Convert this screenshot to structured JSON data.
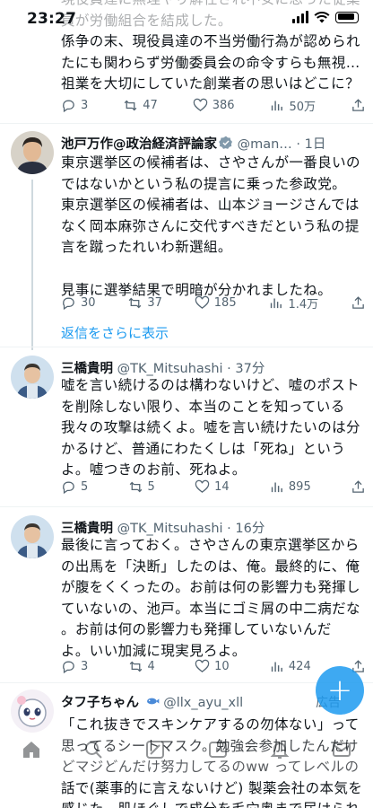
{
  "status_bar": {
    "time": "23:27"
  },
  "top_tweet": {
    "lines": [
      "現役員達に無理やり解任され不安に思った従業",
      "員が労働組合を結成した。",
      "係争の末、現役員達の不当労働行為が認められ",
      "たにも関わらず労働委員会の命令すらも無視…",
      "祖業を大切にしていた創業者の思いはどこに？"
    ],
    "actions": {
      "replies": "3",
      "retweets": "47",
      "likes": "386",
      "views": "50万"
    }
  },
  "tweet_ikedo": {
    "name": "池戸万作@政治経済評論家",
    "handle": "@man…",
    "time": "· 1日",
    "lines": [
      "東京選挙区の候補者は、さやさんが一番良いの",
      "ではないかという私の提言に乗った参政党。",
      "東京選挙区の候補者は、山本ジョージさんでは",
      "なく岡本麻弥さんに交代すべきだという私の提",
      "言を蹴ったれいわ新選組。",
      "",
      "見事に選挙結果で明暗が分かれましたね。"
    ],
    "actions": {
      "replies": "30",
      "retweets": "37",
      "likes": "185",
      "views": "1.4万"
    }
  },
  "show_more_replies": "返信をさらに表示",
  "tweet_mitsuhashi_1": {
    "name": "三橋貴明",
    "handle": "@TK_Mitsuhashi",
    "time": "· 37分",
    "lines": [
      "嘘を言い続けるのは構わないけど、嘘のポスト",
      "を削除しない限り、本当のことを知っている",
      "我々の攻撃は続くよ。嘘を言い続けたいのは分",
      "かるけど、普通にわたくしは「死ね」という",
      "よ。嘘つきのお前、死ねよ。"
    ],
    "actions": {
      "replies": "5",
      "retweets": "5",
      "likes": "14",
      "views": "895"
    }
  },
  "tweet_mitsuhashi_2": {
    "name": "三橋貴明",
    "handle": "@TK_Mitsuhashi",
    "time": "· 16分",
    "lines": [
      "最後に言っておく。さやさんの東京選挙区から",
      "の出馬を「決断」したのは、俺。最終的に、俺",
      "が腹をくくったの。お前は何の影響力も発揮し",
      "ていないの、池戸。本当にゴミ屑の中二病だな",
      "。お前は何の影響力も発揮していないんだ",
      "よ。いい加減に現実見ろよ。"
    ],
    "actions": {
      "replies": "3",
      "retweets": "4",
      "likes": "10",
      "views": "424"
    }
  },
  "ad_tweet": {
    "name": "タフ子ちゃん",
    "handle": "@llx_ayu_xll",
    "ad_label": "広告",
    "lines": [
      "「これ抜きでスキンケアするの勿体ない」って",
      "思ってるシートマスク。勉強会参加したんだけ",
      "どマジどんだけ努力してるのww ってレベルの",
      "話で(薬事的に言えないけど) 製薬会社の本気を",
      "感じた。肌ほぐしで成分を毛穴奥まで届けられ"
    ]
  },
  "colors": {
    "accent": "#1d9bf0",
    "text": "#0f1419",
    "muted": "#536471",
    "verified": "#829aab"
  },
  "icons": [
    "reply-icon",
    "retweet-icon",
    "like-icon",
    "views-icon",
    "share-icon",
    "home-icon",
    "search-icon",
    "grok-icon",
    "play-icon",
    "notifications-icon",
    "messages-icon",
    "compose-icon"
  ]
}
